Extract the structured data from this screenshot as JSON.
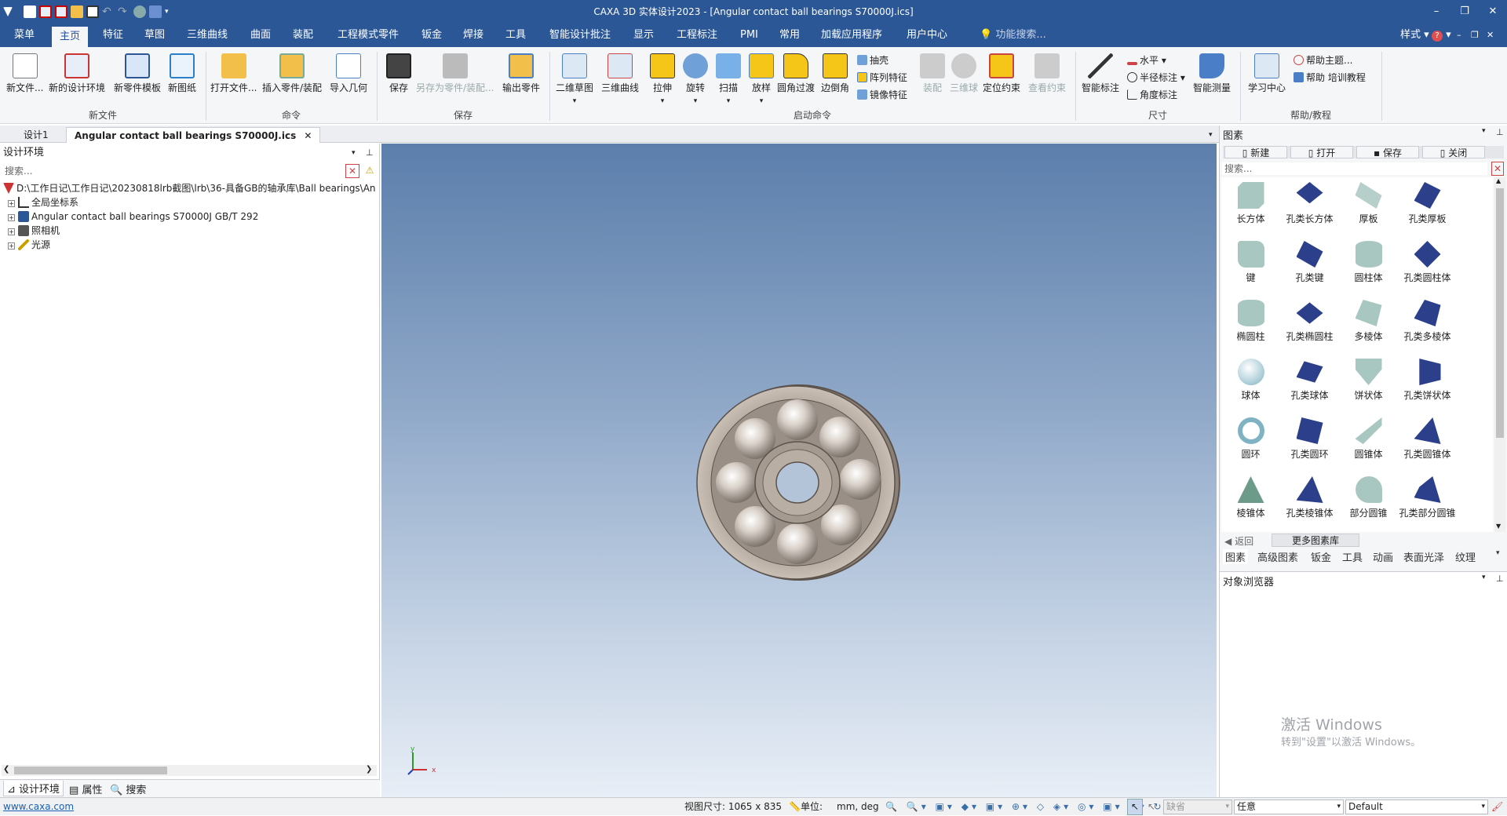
{
  "window": {
    "title": "CAXA 3D 实体设计2023 - [Angular contact ball bearings S70000J.ics]",
    "controls": {
      "minimize": "–",
      "restore": "❐",
      "close": "✕"
    }
  },
  "menubar": {
    "items": [
      "菜单",
      "主页",
      "特征",
      "草图",
      "三维曲线",
      "曲面",
      "装配",
      "工程模式零件",
      "钣金",
      "焊接",
      "工具",
      "智能设计批注",
      "显示",
      "工程标注",
      "PMI",
      "常用",
      "加载应用程序",
      "用户中心"
    ],
    "search_placeholder": "功能搜索...",
    "style_label": "样式",
    "help_icon": "?"
  },
  "ribbon": {
    "new_file": {
      "buttons": [
        "新文件...",
        "新的设计环境",
        "新零件模板",
        "新图纸"
      ],
      "group": "新文件"
    },
    "command": {
      "buttons": [
        "打开文件...",
        "插入零件/装配",
        "导入几何"
      ],
      "group": "命令"
    },
    "save": {
      "buttons": [
        "保存",
        "另存为零件/装配...",
        "输出零件"
      ],
      "group": "保存"
    },
    "launch": {
      "buttons": [
        "二维草图",
        "三维曲线",
        "拉伸",
        "旋转",
        "扫描",
        "放样",
        "圆角过渡",
        "边倒角"
      ],
      "small": [
        "抽壳",
        "阵列特征",
        "镜像特征"
      ],
      "disabled": [
        "装配",
        "三维球"
      ],
      "more": [
        "定位约束"
      ],
      "disabled2": [
        "查看约束"
      ],
      "group": "启动命令"
    },
    "dimension": {
      "buttons": [
        "智能标注"
      ],
      "small": [
        "水平",
        "半径标注",
        "角度标注"
      ],
      "measure": "智能测量",
      "group": "尺寸"
    },
    "help": {
      "buttons": [
        "学习中心"
      ],
      "small": [
        "帮助主题...",
        "帮助 培训教程"
      ],
      "group": "帮助/教程"
    }
  },
  "doc_tabs": [
    "设计1",
    "Angular contact ball bearings S70000J.ics"
  ],
  "left_panel": {
    "title": "设计环境",
    "search_placeholder": "搜索...",
    "tree": [
      "D:\\工作日记\\工作日记\\20230818lrb截图\\lrb\\36-具备GB的轴承库\\Ball bearings\\An",
      "全局坐标系",
      "Angular contact ball bearings S70000J GB/T 292",
      "照相机",
      "光源"
    ],
    "bottom_tabs": [
      "设计环境",
      "属性",
      "搜索"
    ]
  },
  "viewport": {
    "axis_labels": {
      "x": "x",
      "y": "y"
    }
  },
  "right_panel": {
    "title": "图素",
    "toolbar": [
      "新建",
      "打开",
      "保存",
      "关闭"
    ],
    "search_placeholder": "搜索...",
    "items": [
      "长方体",
      "孔类长方体",
      "厚板",
      "孔类厚板",
      "键",
      "孔类键",
      "圆柱体",
      "孔类圆柱体",
      "椭圆柱",
      "孔类椭圆柱",
      "多棱体",
      "孔类多棱体",
      "球体",
      "孔类球体",
      "饼状体",
      "孔类饼状体",
      "圆环",
      "孔类圆环",
      "圆锥体",
      "孔类圆锥体",
      "棱锥体",
      "孔类棱锥体",
      "部分圆锥",
      "孔类部分圆锥"
    ],
    "back_label": "返回",
    "more_label": "更多图素库",
    "tabs": [
      "图素",
      "高级图素",
      "钣金",
      "工具",
      "动画",
      "表面光泽",
      "纹理"
    ],
    "browser_title": "对象浏览器",
    "watermark_line1": "激活 Windows",
    "watermark_line2": "转到\"设置\"以激活 Windows。"
  },
  "statusbar": {
    "link": "www.caxa.com",
    "view_size": "视图尺寸: 1065 x  835",
    "unit_label": "单位:",
    "unit_value": "mm, deg",
    "mode_placeholder": "缺省",
    "select_value": "任意",
    "style_value": "Default"
  }
}
